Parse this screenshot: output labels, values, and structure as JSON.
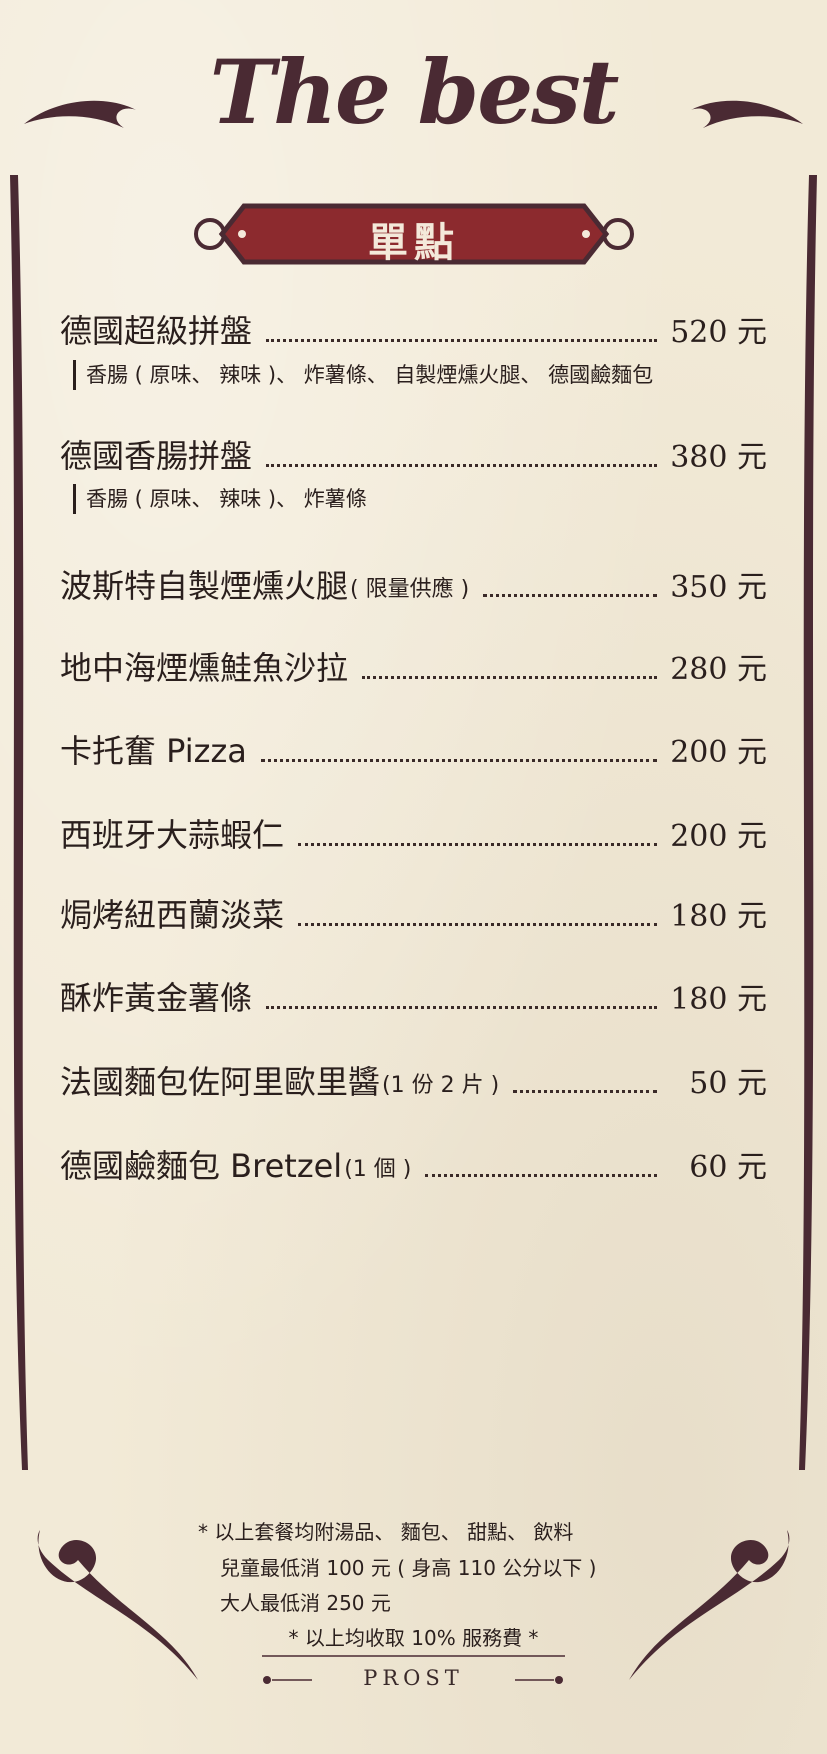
{
  "header": {
    "title": "The best",
    "section": "單點"
  },
  "colors": {
    "background": "#f2ead7",
    "ink": "#2a1f1d",
    "accent": "#8c2a2e",
    "frame": "#4a2a33"
  },
  "menu": [
    {
      "name": "德國超級拼盤",
      "note": "",
      "price": "520 元",
      "desc": "香腸 ( 原味、 辣味 )、 炸薯條、 自製煙燻火腿、 德國鹼麵包"
    },
    {
      "name": "德國香腸拼盤",
      "note": "",
      "price": "380 元",
      "desc": "香腸 ( 原味、 辣味 )、 炸薯條"
    },
    {
      "name": "波斯特自製煙燻火腿",
      "note": "( 限量供應 )",
      "price": "350 元",
      "desc": ""
    },
    {
      "name": "地中海煙燻鮭魚沙拉",
      "note": "",
      "price": "280 元",
      "desc": ""
    },
    {
      "name": "卡托奮 Pizza",
      "note": "",
      "price": "200 元",
      "desc": ""
    },
    {
      "name": "西班牙大蒜蝦仁",
      "note": "",
      "price": "200 元",
      "desc": ""
    },
    {
      "name": "焗烤紐西蘭淡菜",
      "note": "",
      "price": "180 元",
      "desc": ""
    },
    {
      "name": "酥炸黃金薯條",
      "note": "",
      "price": "180 元",
      "desc": ""
    },
    {
      "name": "法國麵包佐阿里歐里醬",
      "note": "(1 份 2 片 )",
      "price": "50 元",
      "desc": ""
    },
    {
      "name": "德國鹼麵包 Bretzel",
      "note": "(1 個 )",
      "price": "60 元",
      "desc": ""
    }
  ],
  "footer": {
    "line1": "* 以上套餐均附湯品、 麵包、 甜點、 飲料",
    "line2": "兒童最低消 100 元 ( 身高 110 公分以下 )",
    "line3": "大人最低消 250 元",
    "service": "* 以上均收取 10% 服務費 *",
    "signature": "PROST"
  }
}
